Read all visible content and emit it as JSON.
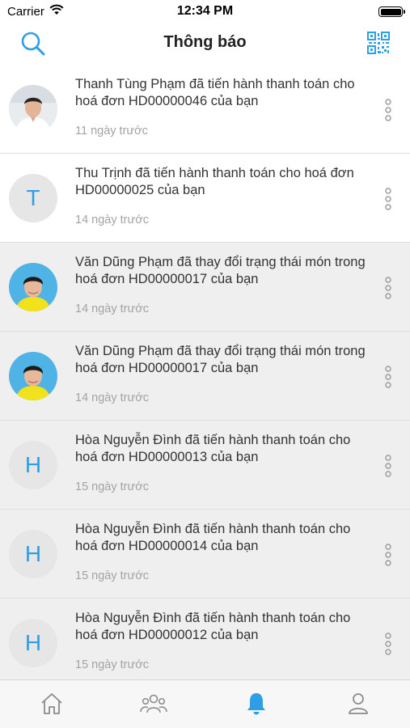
{
  "status": {
    "carrier": "Carrier",
    "time": "12:34 PM"
  },
  "nav": {
    "title": "Thông báo"
  },
  "notifications": [
    {
      "message": "Thanh Tùng Phạm đã tiến hành thanh toán cho hoá đơn HD00000046 của bạn",
      "time": "11 ngày trước",
      "avatar": "photo",
      "state": "read"
    },
    {
      "message": "Thu Trịnh đã tiến hành thanh toán cho hoá đơn HD00000025 của bạn",
      "time": "14 ngày trước",
      "avatar": "T",
      "state": "read"
    },
    {
      "message": "Văn Dũng Phạm đã thay đổi trạng thái món trong hoá đơn HD00000017 của bạn",
      "time": "14 ngày trước",
      "avatar": "photo",
      "state": "unread"
    },
    {
      "message": "Văn Dũng Phạm đã thay đổi trạng thái món trong hoá đơn HD00000017 của bạn",
      "time": "14 ngày trước",
      "avatar": "photo",
      "state": "unread"
    },
    {
      "message": "Hòa Nguyễn Đình đã tiến hành thanh toán cho hoá đơn HD00000013 của bạn",
      "time": "15 ngày trước",
      "avatar": "H",
      "state": "unread"
    },
    {
      "message": "Hòa Nguyễn Đình đã tiến hành thanh toán cho hoá đơn HD00000014 của bạn",
      "time": "15 ngày trước",
      "avatar": "H",
      "state": "unread"
    },
    {
      "message": "Hòa Nguyễn Đình đã tiến hành thanh toán cho hoá đơn HD00000012 của bạn",
      "time": "15 ngày trước",
      "avatar": "H",
      "state": "unread"
    }
  ],
  "tabs": [
    {
      "icon": "home-icon",
      "active": false
    },
    {
      "icon": "group-icon",
      "active": false
    },
    {
      "icon": "bell-icon",
      "active": true
    },
    {
      "icon": "user-icon",
      "active": false
    }
  ],
  "colors": {
    "accent": "#2e9fe6",
    "unread_bg": "#efefef",
    "icon_gray": "#8a8a8a"
  }
}
